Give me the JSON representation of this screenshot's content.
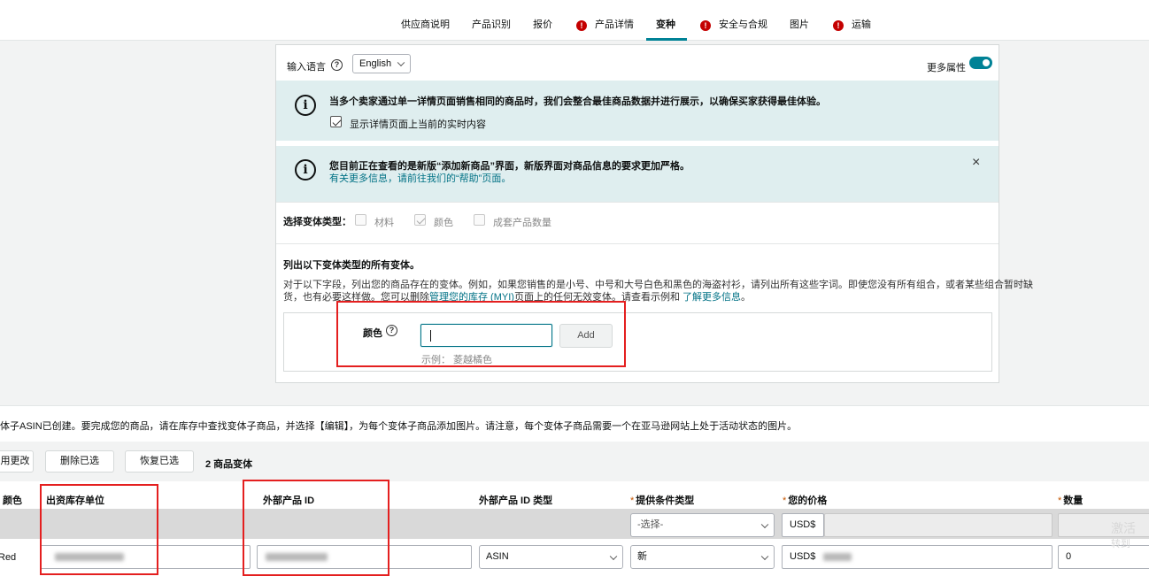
{
  "top_tabs": [
    {
      "label": "供应商说明",
      "error": false
    },
    {
      "label": "产品识别",
      "error": false
    },
    {
      "label": "报价",
      "error": false
    },
    {
      "label": "产品详情",
      "error": true
    },
    {
      "label": "变种",
      "error": false,
      "active": true
    },
    {
      "label": "安全与合规",
      "error": true
    },
    {
      "label": "图片",
      "error": false
    },
    {
      "label": "运输",
      "error": true
    }
  ],
  "error_glyph": "!",
  "language": {
    "label": "输入语言",
    "help": "?",
    "value": "English"
  },
  "more_attributes": {
    "label": "更多属性",
    "enabled": true
  },
  "info_glyph": "i",
  "alert1": {
    "text": "当多个卖家通过单一详情页面销售相同的商品时，我们会整合最佳商品数据并进行展示，以确保买家获得最佳体验。",
    "checkbox_label": "显示详情页面上当前的实时内容",
    "checked": true
  },
  "alert2": {
    "text": "您目前正在查看的是新版“添加新商品”界面，新版界面对商品信息的要求更加严格。",
    "link": "有关更多信息，请前往我们的“帮助”页面。",
    "close": "×"
  },
  "variation_type": {
    "label": "选择变体类型：",
    "options": [
      {
        "label": "材料",
        "checked": false
      },
      {
        "label": "颜色",
        "checked": true
      },
      {
        "label": "成套产品数量",
        "checked": false
      }
    ]
  },
  "list_section": {
    "title": "列出以下变体类型的所有变体。",
    "desc_line1": "对于以下字段，列出您的商品存在的变体。例如，如果您销售的是小号、中号和大号白色和黑色的海盗衬衫，请列出所有这些字词。即使您没有所有组合，或者某些组合暂时缺",
    "desc_line2_a": "货，也有必要这样做。您可以删除",
    "desc_link1": "管理您的库存 (MYI)",
    "desc_line2_b": "页面上的任何无效变体。请查看示例和",
    "desc_link2": "了解更多信息",
    "desc_end": "。"
  },
  "color_field": {
    "label": "颜色",
    "help": "?",
    "value": "",
    "add_label": "Add",
    "example": "示例： 菱越橘色"
  },
  "bottom": {
    "notice": "体子ASIN已创建。要完成您的商品，请在库存中查找变体子商品，并选择【编辑】，为每个变体子商品添加图片。请注意，每个变体子商品需要一个在亚马逊网站上处于活动状态的图片。",
    "buttons": [
      "用更改",
      "删除已选",
      "恢复已选"
    ],
    "count": "2 商品变体",
    "required_mark": "*",
    "columns": {
      "color": "颜色",
      "sku": "出资库存单位",
      "ext_id": "外部产品 ID",
      "ext_id_type": "外部产品 ID 类型",
      "condition": "提供条件类型",
      "price": "您的价格",
      "qty": "数量"
    },
    "template_row": {
      "condition": "-选择-",
      "currency": "USD$"
    },
    "row": {
      "color": "Red",
      "ext_id_type": "ASIN",
      "condition": "新",
      "currency": "USD$",
      "qty": "0"
    }
  },
  "watermark": {
    "line1": "激活",
    "line2": "转到"
  }
}
